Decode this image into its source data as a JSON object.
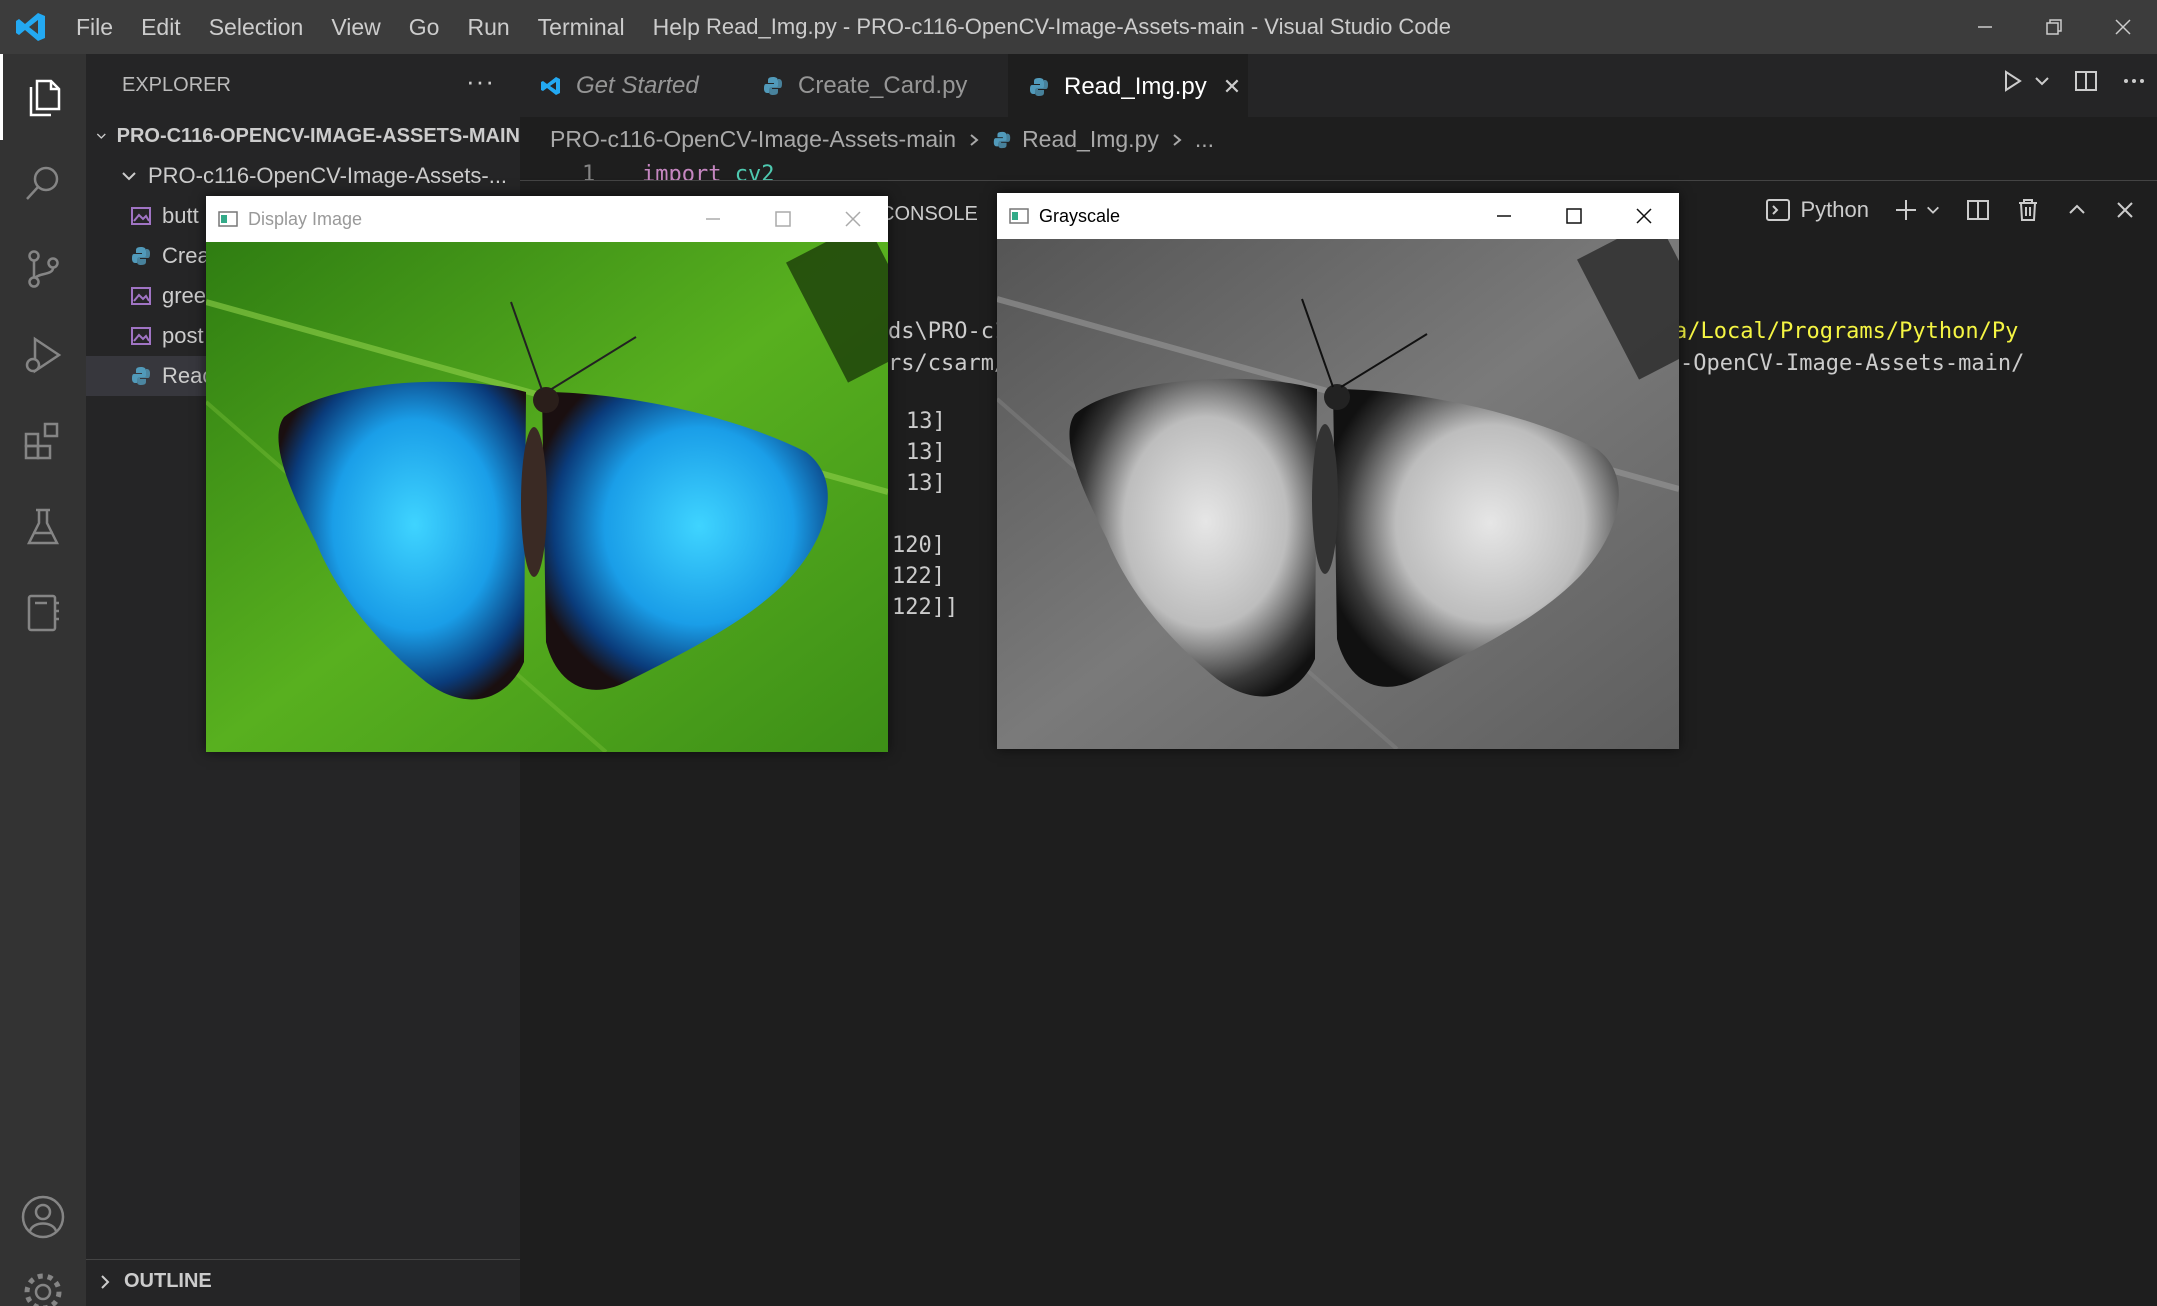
{
  "app": {
    "menu": [
      "File",
      "Edit",
      "Selection",
      "View",
      "Go",
      "Run",
      "Terminal",
      "Help"
    ],
    "window_title": "Read_Img.py - PRO-c116-OpenCV-Image-Assets-main - Visual Studio Code"
  },
  "sidebar": {
    "header": "EXPLORER",
    "more": "···",
    "root": "PRO-C116-OPENCV-IMAGE-ASSETS-MAIN",
    "folder": "PRO-c116-OpenCV-Image-Assets-...",
    "items": [
      {
        "label": "butt",
        "type": "image"
      },
      {
        "label": "Crea",
        "type": "python"
      },
      {
        "label": "gree",
        "type": "image"
      },
      {
        "label": "post",
        "type": "image"
      },
      {
        "label": "Reac",
        "type": "python"
      }
    ],
    "outline": "OUTLINE"
  },
  "editor": {
    "tabs": [
      {
        "label": "Get Started"
      },
      {
        "label": "Create_Card.py"
      },
      {
        "label": "Read_Img.py",
        "close": "✕"
      }
    ],
    "breadcrumb": {
      "folder": "PRO-c116-OpenCV-Image-Assets-main",
      "file": "Read_Img.py",
      "more": "..."
    },
    "line_number": "1",
    "code_keyword": "import",
    "code_module": "cv2"
  },
  "panel": {
    "tab": "CONSOLE",
    "shell": "Python",
    "lines": [
      "ds\\PRO-c1",
      "rs/csarm/",
      "13]",
      "13]",
      "13]",
      "120]",
      "122]",
      "122]]"
    ],
    "right_lines": [
      "a/Local/Programs/Python/Py",
      "-OpenCV-Image-Assets-main/"
    ]
  },
  "windows": {
    "display": {
      "title": "Display Image"
    },
    "gray": {
      "title": "Grayscale"
    }
  },
  "colors": {
    "accent": "#007acc",
    "python_icon": "#519aba",
    "image_icon": "#a074c4"
  }
}
